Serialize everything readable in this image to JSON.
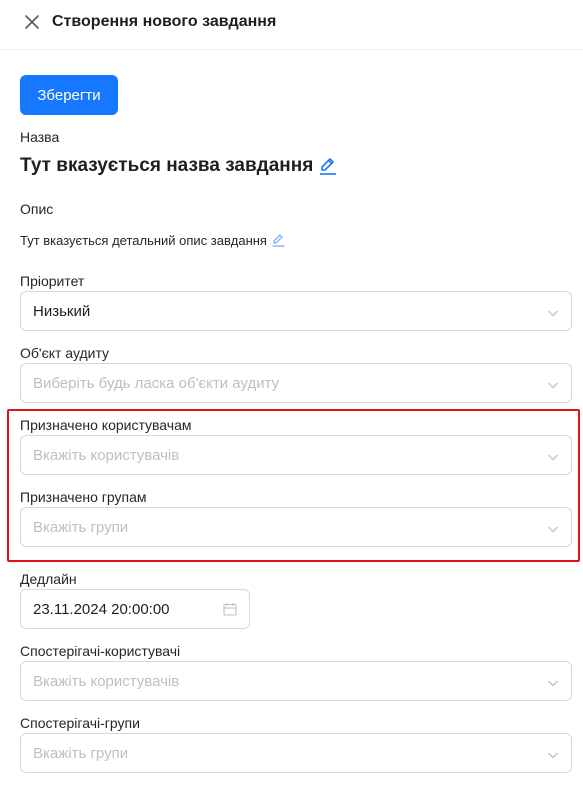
{
  "header": {
    "title": "Створення нового завдання"
  },
  "toolbar": {
    "save_label": "Зберегти"
  },
  "name": {
    "label": "Назва",
    "value": "Тут вказується назва завдання"
  },
  "description": {
    "label": "Опис",
    "value": "Тут вказується детальний опис завдання"
  },
  "priority": {
    "label": "Пріоритет",
    "value": "Низький"
  },
  "audit_object": {
    "label": "Об'єкт аудиту",
    "placeholder": "Виберіть будь ласка об'єкти аудиту"
  },
  "assigned_users": {
    "label": "Призначено користувачам",
    "placeholder": "Вкажіть користувачів"
  },
  "assigned_groups": {
    "label": "Призначено групам",
    "placeholder": "Вкажіть групи"
  },
  "deadline": {
    "label": "Дедлайн",
    "value": "23.11.2024 20:00:00"
  },
  "observer_users": {
    "label": "Спостерігачі-користувачі",
    "placeholder": "Вкажіть користувачів"
  },
  "observer_groups": {
    "label": "Спостерігачі-групи",
    "placeholder": "Вкажіть групи"
  },
  "colors": {
    "accent": "#1677ff",
    "highlight": "#e0121b"
  }
}
